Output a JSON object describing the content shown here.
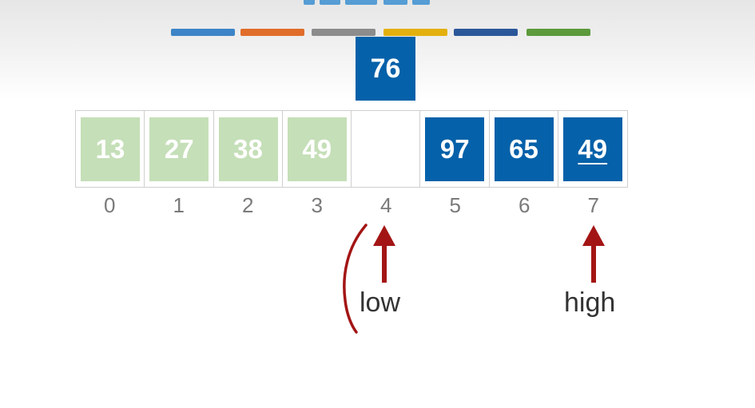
{
  "colors": {
    "cell_done": "#c5dfb8",
    "cell_active": "#0561a9",
    "pointer_arrow": "#a31515",
    "index_text": "#7a7a7a"
  },
  "color_bars": [
    "#3d85c6",
    "#e06d2a",
    "#8c8c8c",
    "#e4b00e",
    "#2b579a",
    "#5c9a3c"
  ],
  "pivot": {
    "value": "76"
  },
  "array": {
    "cells": [
      {
        "index": "0",
        "value": "13",
        "state": "done"
      },
      {
        "index": "1",
        "value": "27",
        "state": "done"
      },
      {
        "index": "2",
        "value": "38",
        "state": "done"
      },
      {
        "index": "3",
        "value": "49",
        "state": "done"
      },
      {
        "index": "4",
        "value": "",
        "state": "empty"
      },
      {
        "index": "5",
        "value": "97",
        "state": "active"
      },
      {
        "index": "6",
        "value": "65",
        "state": "active"
      },
      {
        "index": "7",
        "value": "49",
        "state": "active-underlined"
      }
    ]
  },
  "pointers": {
    "low": {
      "label": "low",
      "index": 4
    },
    "high": {
      "label": "high",
      "index": 7
    }
  }
}
